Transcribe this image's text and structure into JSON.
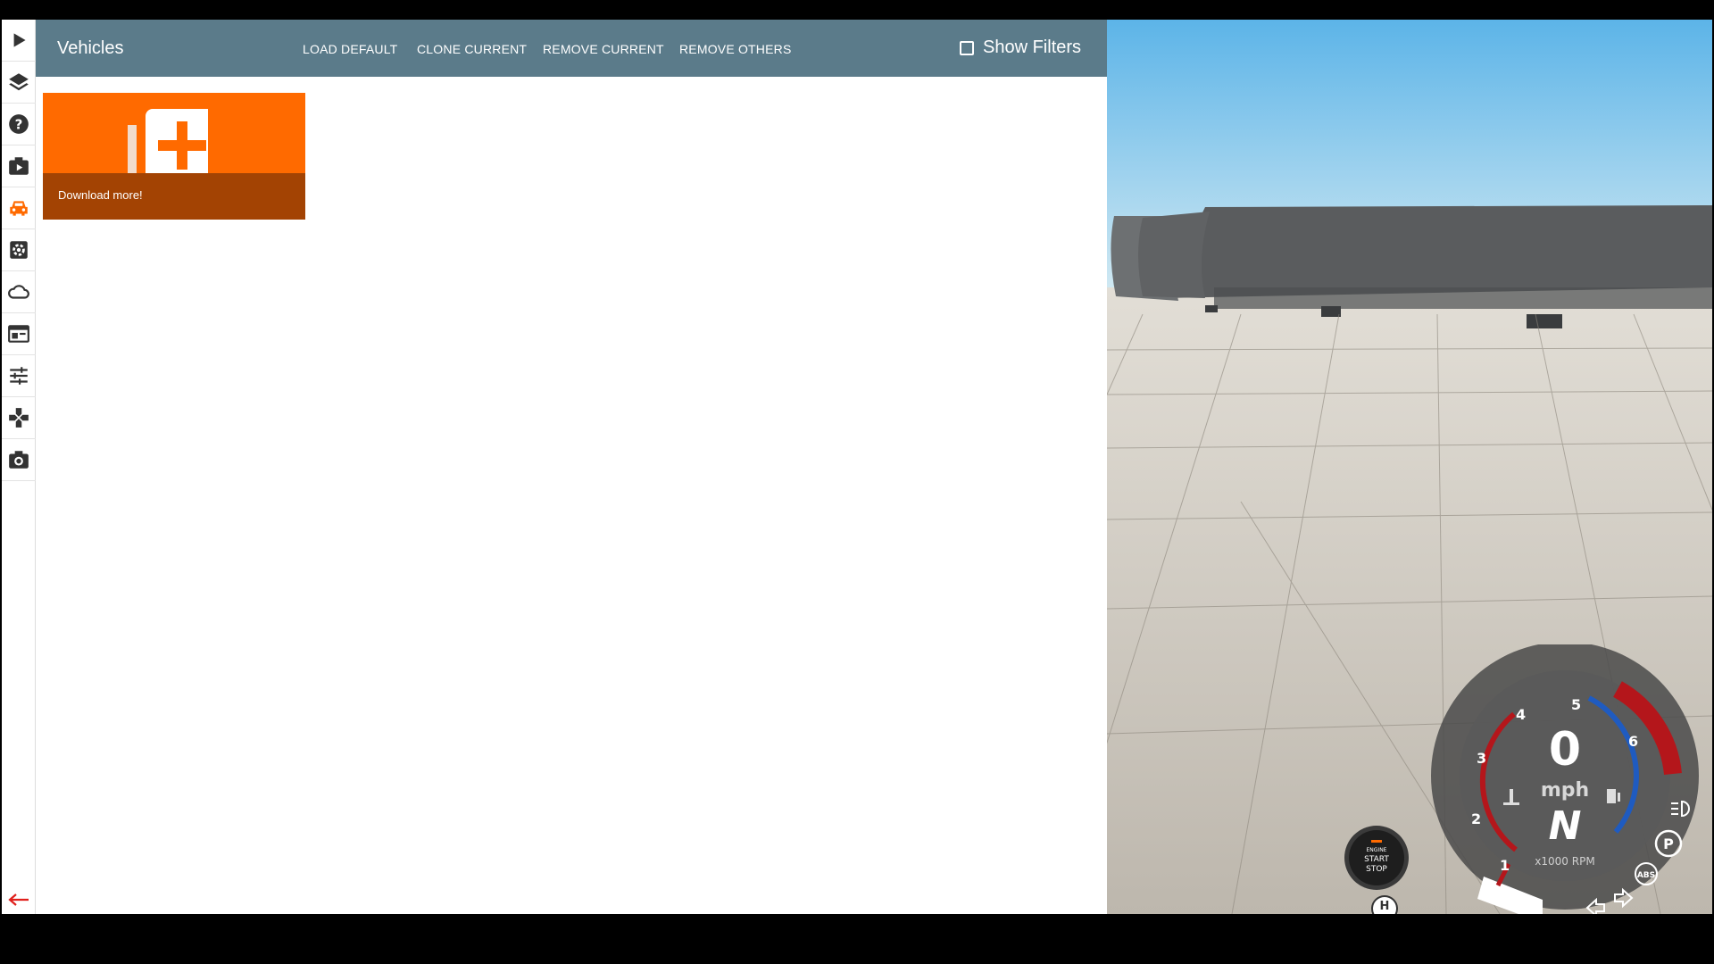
{
  "sidebar": {
    "items": [
      {
        "name": "play-icon",
        "color": "#333"
      },
      {
        "name": "layers-icon",
        "color": "#333"
      },
      {
        "name": "help-icon",
        "color": "#333"
      },
      {
        "name": "scenario-icon",
        "color": "#333"
      },
      {
        "name": "vehicle-icon",
        "color": "#ff6a00"
      },
      {
        "name": "settings-icon",
        "color": "#333"
      },
      {
        "name": "cloud-icon",
        "color": "#333"
      },
      {
        "name": "ui-apps-icon",
        "color": "#333"
      },
      {
        "name": "options-sliders-icon",
        "color": "#333"
      },
      {
        "name": "controls-icon",
        "color": "#333"
      },
      {
        "name": "camera-icon",
        "color": "#333"
      }
    ],
    "back_icon": "arrow-left-icon"
  },
  "header": {
    "title": "Vehicles",
    "actions": [
      "LOAD DEFAULT",
      "CLONE CURRENT",
      "REMOVE CURRENT",
      "REMOVE OTHERS"
    ],
    "filter_label": "Show Filters",
    "filter_checked": false
  },
  "tiles": [
    {
      "label": "Download more!",
      "icon": "add-vehicle-icon",
      "color": "#ff6a00"
    }
  ],
  "hud": {
    "speed": "0",
    "speed_unit": "mph",
    "gear": "N",
    "rpm_unit": "x1000 RPM",
    "rpm_ticks": [
      "1",
      "2",
      "3",
      "4",
      "5",
      "6"
    ],
    "engine_button": [
      "ENGINE",
      "START",
      "STOP"
    ],
    "abs_label": "ABS",
    "park_label": "P",
    "hold_label": "H"
  },
  "colors": {
    "accent": "#ff6a00",
    "header": "#5b7b8a",
    "redline": "#b4161b",
    "fuel_arc": "#1f5bc0"
  }
}
